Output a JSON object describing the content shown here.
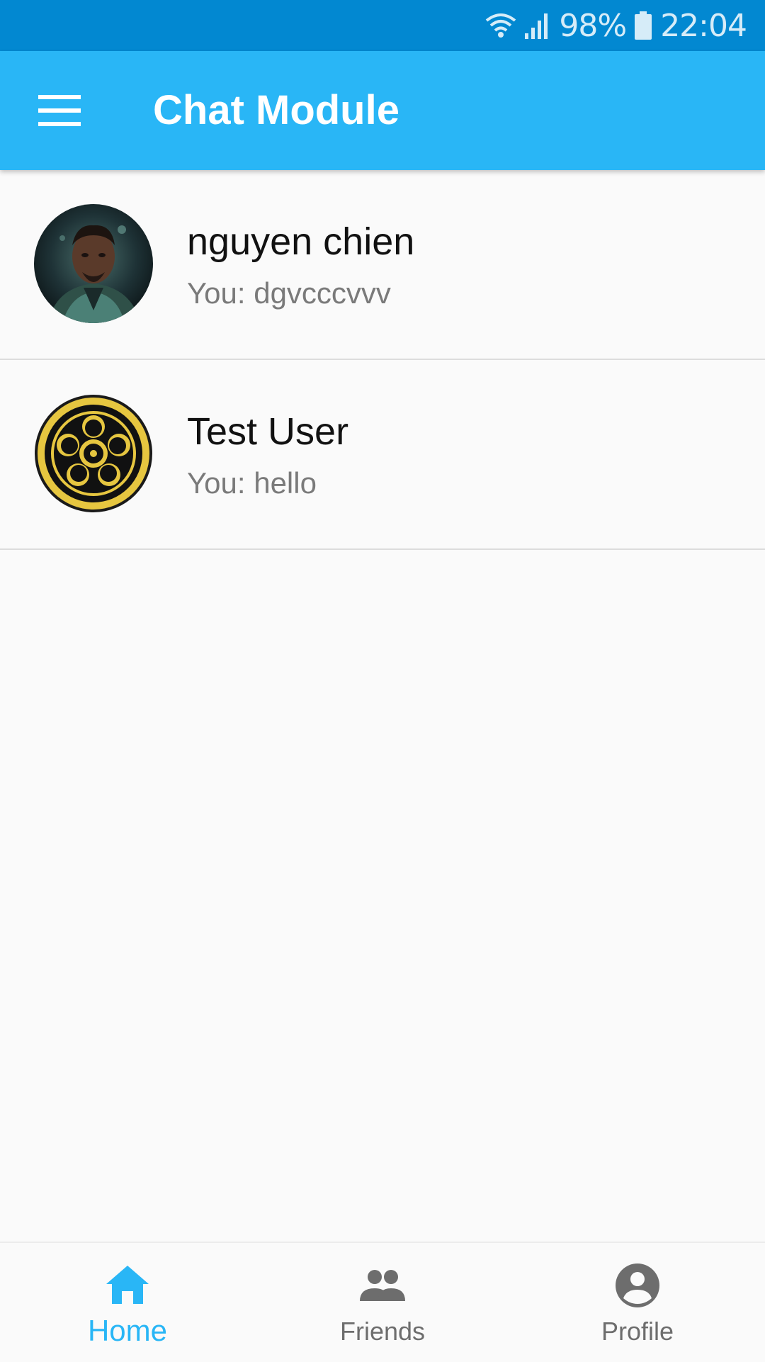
{
  "status_bar": {
    "battery": "98%",
    "time": "22:04",
    "icons": [
      "wifi-icon",
      "signal-icon",
      "battery-icon"
    ]
  },
  "app_bar": {
    "title": "Chat Module",
    "menu_icon": "menu-icon"
  },
  "chats": [
    {
      "name": "nguyen chien",
      "preview": "You: dgvcccvvv",
      "avatar": "portrait-avatar"
    },
    {
      "name": "Test User",
      "preview": "You: hello",
      "avatar": "crest-avatar"
    }
  ],
  "bottom_nav": {
    "items": [
      {
        "label": "Home",
        "icon": "home-icon",
        "active": true
      },
      {
        "label": "Friends",
        "icon": "friends-icon",
        "active": false
      },
      {
        "label": "Profile",
        "icon": "profile-icon",
        "active": false
      }
    ]
  },
  "colors": {
    "status_bar": "#0288d1",
    "app_bar": "#29b6f6",
    "accent": "#29b6f6",
    "inactive": "#6d6d6d",
    "background": "#fafafa"
  }
}
